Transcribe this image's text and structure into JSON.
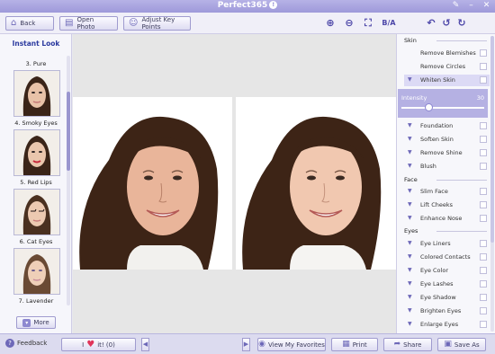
{
  "window": {
    "title": "Perfect365",
    "title_badge": "!"
  },
  "toolbar": {
    "back_label": "Back",
    "open_photo_label": "Open Photo",
    "adjust_key_points_label": "Adjust Key Points",
    "before_after_label": "B/A"
  },
  "left_panel": {
    "title": "Instant Look",
    "looks": [
      {
        "label": "3. Pure"
      },
      {
        "label": "4. Smoky Eyes"
      },
      {
        "label": "5. Red Lips"
      },
      {
        "label": "6. Cat Eyes"
      },
      {
        "label": "7. Lavender"
      }
    ],
    "more_label": "More"
  },
  "right_panel": {
    "skin": {
      "title": "Skin",
      "items": [
        "Remove Blemishes",
        "Remove Circles",
        "Whiten Skin"
      ],
      "intensity_label": "Intensity",
      "intensity_value": 30,
      "more_items": [
        "Foundation",
        "Soften Skin",
        "Remove Shine",
        "Blush"
      ]
    },
    "face": {
      "title": "Face",
      "items": [
        "Slim Face",
        "Lift Cheeks",
        "Enhance Nose"
      ]
    },
    "eyes": {
      "title": "Eyes",
      "items": [
        "Eye Liners",
        "Colored Contacts",
        "Eye Color",
        "Eye Lashes",
        "Eye Shadow",
        "Brighten Eyes",
        "Enlarge Eyes"
      ]
    }
  },
  "bottom_bar": {
    "feedback_label": "Feedback",
    "love_prefix": "I",
    "love_suffix": "it! (0)",
    "favorites_label": "View My Favorites",
    "print_label": "Print",
    "share_label": "Share",
    "save_as_label": "Save As"
  },
  "colors": {
    "accent": "#9e99da",
    "section_title": "#2b3a9f",
    "heart": "#e0345a"
  }
}
